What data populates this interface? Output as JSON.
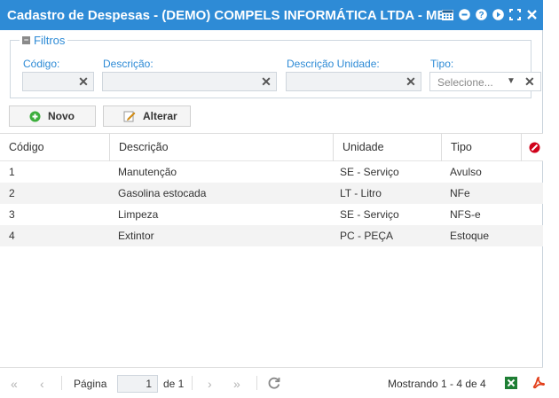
{
  "window": {
    "title": "Cadastro de Despesas - (DEMO) COMPELS INFORMÁTICA LTDA - ME ..."
  },
  "title_icons": [
    "calendar-icon",
    "minimize-icon",
    "help-icon",
    "next-icon",
    "maximize-icon",
    "close-icon"
  ],
  "filters": {
    "legend": "Filtros",
    "codigo_label": "Código:",
    "codigo_value": "",
    "descricao_label": "Descrição:",
    "descricao_value": "",
    "unidade_label": "Descrição Unidade:",
    "unidade_value": "",
    "tipo_label": "Tipo:",
    "tipo_placeholder": "Selecione..."
  },
  "toolbar": {
    "novo_label": "Novo",
    "alterar_label": "Alterar"
  },
  "table": {
    "columns": [
      "Código",
      "Descrição",
      "Unidade",
      "Tipo"
    ],
    "rows": [
      [
        "1",
        "Manutenção",
        "SE - Serviço",
        "Avulso"
      ],
      [
        "2",
        "Gasolina estocada",
        "LT - Litro",
        "NFe"
      ],
      [
        "3",
        "Limpeza",
        "SE - Serviço",
        "NFS-e"
      ],
      [
        "4",
        "Extintor",
        "PC - PEÇA",
        "Estoque"
      ]
    ]
  },
  "pager": {
    "page_label": "Página",
    "page_value": "1",
    "of_label": "de 1",
    "showing": "Mostrando 1 - 4 de 4"
  },
  "colors": {
    "titlebar": "#2e8bd6",
    "accent": "#2e8bd6",
    "excel": "#1e7e34",
    "pdf": "#e2401c",
    "clear_col": "#d0021b"
  }
}
